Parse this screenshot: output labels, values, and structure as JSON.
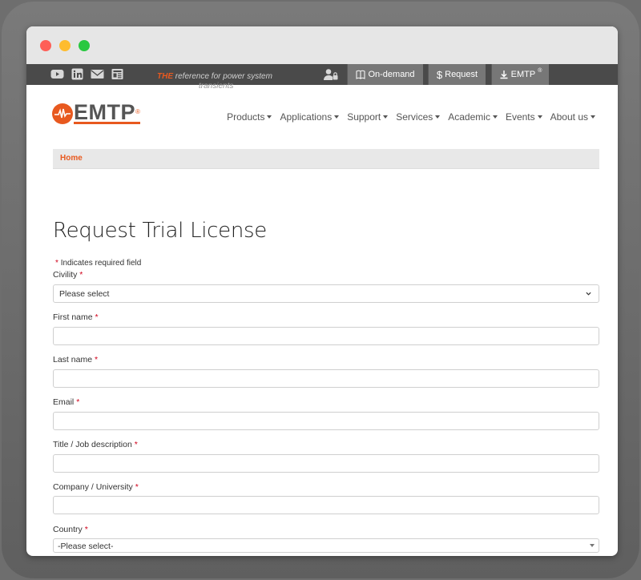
{
  "topbar": {
    "tagline_strong": "THE",
    "tagline_rest": " reference for power system",
    "tagline_wrap": "transients",
    "buttons": [
      {
        "label": "On-demand",
        "icon": "book-icon"
      },
      {
        "label": "Request",
        "prefix": "$",
        "icon": "dollar-icon"
      },
      {
        "label": "EMTP",
        "sup": "®",
        "icon": "download-icon"
      }
    ],
    "social_icons": [
      "youtube-icon",
      "linkedin-icon",
      "mail-icon",
      "newsletter-icon"
    ]
  },
  "header": {
    "logo_text": "EMTP",
    "logo_sup": "®",
    "nav": [
      "Products",
      "Applications",
      "Support",
      "Services",
      "Academic",
      "Events",
      "About us"
    ]
  },
  "breadcrumb": {
    "home": "Home"
  },
  "form": {
    "title": "Request Trial License",
    "required_note": "Indicates required field",
    "required_marker": "*",
    "civility": {
      "label": "Civility",
      "value": "Please select"
    },
    "first_name": {
      "label": "First name",
      "value": ""
    },
    "last_name": {
      "label": "Last name",
      "value": ""
    },
    "email": {
      "label": "Email",
      "value": ""
    },
    "job": {
      "label": "Title / Job description",
      "value": ""
    },
    "company": {
      "label": "Company / University",
      "value": ""
    },
    "country": {
      "label": "Country",
      "value": "-Please select-"
    }
  },
  "colors": {
    "accent": "#e8591f",
    "required": "#d0021b",
    "topbar": "#4a4a4a"
  }
}
